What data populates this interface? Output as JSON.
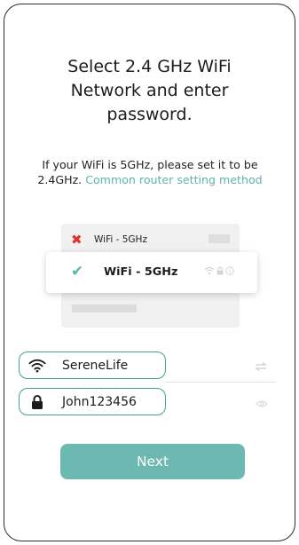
{
  "header": {
    "title_lines": [
      "Select 2.4 GHz WiFi",
      "Network and enter",
      "password."
    ]
  },
  "description": {
    "text": "If your WiFi is 5GHz, please set it to be 2.4GHz. ",
    "link": "Common router setting method"
  },
  "illustration": {
    "wrong_network": "WiFi - 5GHz",
    "selected_network": "WiFi - 5GHz",
    "wrong_icon": "x-icon",
    "selected_icon": "check-icon"
  },
  "form": {
    "ssid": {
      "value": "SereneLife",
      "icon": "wifi-icon",
      "trailing_icon": "swap-icon"
    },
    "password": {
      "value": "John123456",
      "icon": "lock-icon",
      "trailing_icon": "eye-icon"
    }
  },
  "actions": {
    "next_label": "Next"
  },
  "colors": {
    "accent": "#5fb3ad",
    "button": "#6db8b1",
    "field_border": "#4a9e98",
    "error": "#e0332b"
  }
}
